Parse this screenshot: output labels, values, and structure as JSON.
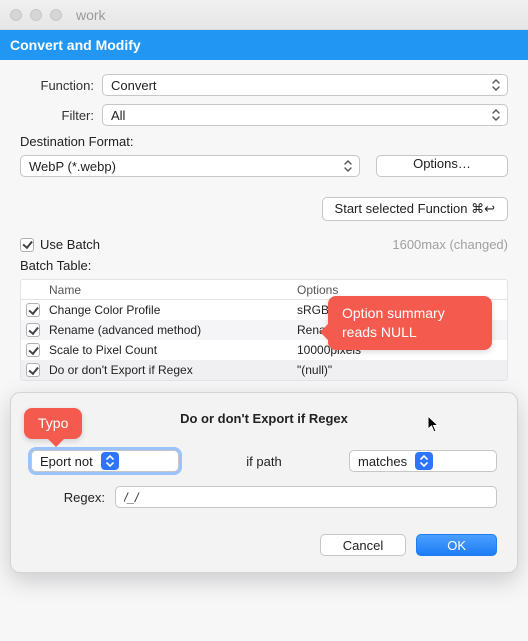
{
  "window": {
    "title": "work"
  },
  "header": {
    "title": "Convert and Modify"
  },
  "labels": {
    "function": "Function:",
    "filter": "Filter:",
    "destination": "Destination Format:"
  },
  "selects": {
    "function": "Convert",
    "filter": "All",
    "destination": "WebP (*.webp)"
  },
  "buttons": {
    "options": "Options…",
    "start": "Start selected Function  ⌘↩︎",
    "cancel": "Cancel",
    "ok": "OK"
  },
  "batch": {
    "use_label": "Use Batch",
    "status": "1600max (changed)",
    "table_label": "Batch Table:",
    "columns": {
      "name": "Name",
      "options": "Options"
    },
    "rows": [
      {
        "checked": true,
        "name": "Change Color Profile",
        "options": "sRGB IEC61966-2"
      },
      {
        "checked": true,
        "name": "Rename (advanced method)",
        "options": "Rename using \"Sp"
      },
      {
        "checked": true,
        "name": "Scale to Pixel Count",
        "options": "10000pixels"
      },
      {
        "checked": true,
        "name": "Do or don't Export if Regex",
        "options": "\"(null)\""
      }
    ]
  },
  "callouts": {
    "null_summary": "Option summary reads NULL",
    "typo": "Typo"
  },
  "dialog": {
    "title": "Do or don't Export if Regex",
    "export_select": "Eport not",
    "if_path": "if path",
    "matches_select": "matches",
    "regex_label": "Regex:",
    "regex_value": "/_/"
  }
}
